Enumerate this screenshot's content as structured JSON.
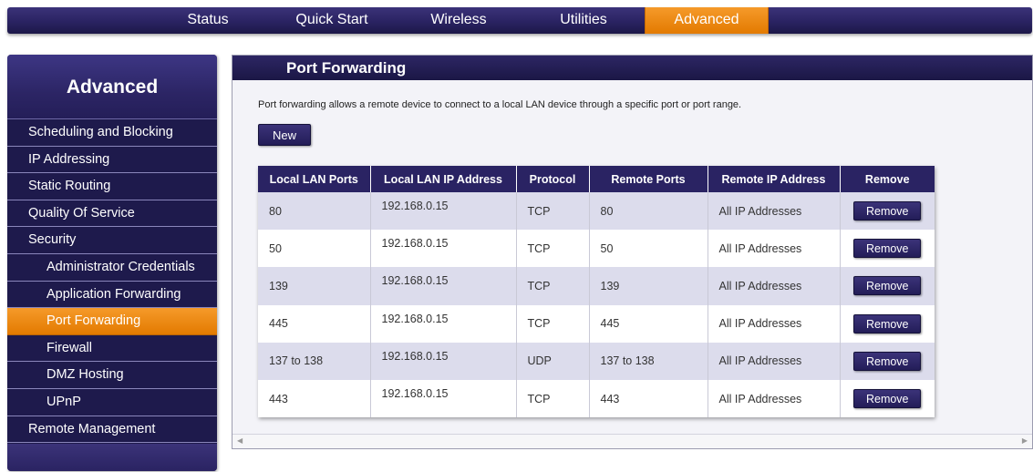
{
  "topnav": {
    "items": [
      {
        "label": "Status",
        "active": false
      },
      {
        "label": "Quick Start",
        "active": false
      },
      {
        "label": "Wireless",
        "active": false
      },
      {
        "label": "Utilities",
        "active": false
      },
      {
        "label": "Advanced",
        "active": true
      }
    ]
  },
  "sidebar": {
    "title": "Advanced",
    "items": [
      {
        "label": "Scheduling and Blocking",
        "sub": false,
        "active": false
      },
      {
        "label": "IP Addressing",
        "sub": false,
        "active": false
      },
      {
        "label": "Static Routing",
        "sub": false,
        "active": false
      },
      {
        "label": "Quality Of Service",
        "sub": false,
        "active": false
      },
      {
        "label": "Security",
        "sub": false,
        "active": false
      },
      {
        "label": "Administrator Credentials",
        "sub": true,
        "active": false
      },
      {
        "label": "Application Forwarding",
        "sub": true,
        "active": false
      },
      {
        "label": "Port Forwarding",
        "sub": true,
        "active": true
      },
      {
        "label": "Firewall",
        "sub": true,
        "active": false
      },
      {
        "label": "DMZ Hosting",
        "sub": true,
        "active": false
      },
      {
        "label": "UPnP",
        "sub": true,
        "active": false
      },
      {
        "label": "Remote Management",
        "sub": false,
        "active": false
      }
    ]
  },
  "main": {
    "title": "Port Forwarding",
    "description": "Port forwarding allows a remote device to connect to a local LAN device through a specific port or port range.",
    "new_label": "New",
    "table": {
      "columns": [
        "Local LAN Ports",
        "Local LAN IP Address",
        "Protocol",
        "Remote Ports",
        "Remote IP Address",
        "Remove"
      ],
      "rows": [
        {
          "local_ports": "80",
          "local_ip": "192.168.0.15",
          "protocol": "TCP",
          "remote_ports": "80",
          "remote_ip": "All IP Addresses",
          "action": "Remove"
        },
        {
          "local_ports": "50",
          "local_ip": "192.168.0.15",
          "protocol": "TCP",
          "remote_ports": "50",
          "remote_ip": "All IP Addresses",
          "action": "Remove"
        },
        {
          "local_ports": "139",
          "local_ip": "192.168.0.15",
          "protocol": "TCP",
          "remote_ports": "139",
          "remote_ip": "All IP Addresses",
          "action": "Remove"
        },
        {
          "local_ports": "445",
          "local_ip": "192.168.0.15",
          "protocol": "TCP",
          "remote_ports": "445",
          "remote_ip": "All IP Addresses",
          "action": "Remove"
        },
        {
          "local_ports": "137 to 138",
          "local_ip": "192.168.0.15",
          "protocol": "UDP",
          "remote_ports": "137 to 138",
          "remote_ip": "All IP Addresses",
          "action": "Remove"
        },
        {
          "local_ports": "443",
          "local_ip": "192.168.0.15",
          "protocol": "TCP",
          "remote_ports": "443",
          "remote_ip": "All IP Addresses",
          "action": "Remove"
        }
      ]
    }
  },
  "colors": {
    "navy": "#2a2363",
    "accent_orange": "#e37a00",
    "row_alt": "#dcdcec"
  },
  "icons": {
    "scroll_left": "chevron-left-icon",
    "scroll_right": "chevron-right-icon"
  }
}
